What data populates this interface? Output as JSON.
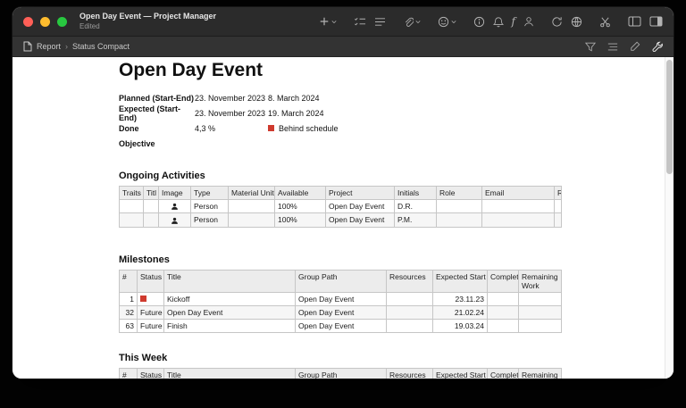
{
  "window": {
    "title": "Open Day Event — Project Manager",
    "subtitle": "Edited"
  },
  "toolbar": {
    "icons": [
      "add",
      "checklist",
      "text-lines",
      "attach",
      "emoji",
      "info",
      "notifications",
      "function",
      "contacts",
      "refresh",
      "globe",
      "cut",
      "panel-left",
      "panel-right"
    ]
  },
  "pathbar": {
    "breadcrumb": [
      "Report",
      "Status Compact"
    ],
    "separator": "›",
    "icons": [
      "filter",
      "outline",
      "style",
      "tools"
    ]
  },
  "page": {
    "title": "Open Day Event",
    "fields": {
      "planned": {
        "label": "Planned (Start-End)",
        "start": "23. November 2023",
        "end": "8. March 2024"
      },
      "expected": {
        "label": "Expected (Start-End)",
        "start": "23. November 2023",
        "end": "19. March 2024"
      },
      "done": {
        "label": "Done",
        "value": "4,3 %",
        "status": "Behind schedule",
        "status_icon": "red-square"
      },
      "objective": {
        "label": "Objective"
      }
    }
  },
  "ongoing": {
    "heading": "Ongoing Activities",
    "columns": [
      "Traits",
      "Titl",
      "Image",
      "Type",
      "Material Unit",
      "Available",
      "Project",
      "Initials",
      "Role",
      "Email",
      "R"
    ],
    "rows": [
      {
        "image_icon": "person",
        "type": "Person",
        "available": "100%",
        "project": "Open Day Event",
        "initials": "D.R."
      },
      {
        "image_icon": "person",
        "type": "Person",
        "available": "100%",
        "project": "Open Day Event",
        "initials": "P.M."
      }
    ]
  },
  "milestones": {
    "heading": "Milestones",
    "columns": [
      "#",
      "Status",
      "Title",
      "Group Path",
      "Resources",
      "Expected Start",
      "Complete",
      "Remaining Work"
    ],
    "rows": [
      {
        "num": "1",
        "status": "",
        "status_icon": "red-square",
        "title": "Kickoff",
        "group": "Open Day Event",
        "expected_start": "23.11.23"
      },
      {
        "num": "32",
        "status": "Future",
        "title": "Open Day Event",
        "group": "Open Day Event",
        "expected_start": "21.02.24"
      },
      {
        "num": "63",
        "status": "Future",
        "title": "Finish",
        "group": "Open Day Event",
        "expected_start": "19.03.24"
      }
    ]
  },
  "this_week": {
    "heading": "This Week",
    "columns": [
      "#",
      "Status",
      "Title",
      "Group Path",
      "Resources",
      "Expected Start",
      "Complete",
      "Remaining Work"
    ]
  },
  "colors": {
    "status_red": "#cf3a2e",
    "traffic_red": "#ff5f57",
    "traffic_yellow": "#febc2e",
    "traffic_green": "#28c840"
  }
}
